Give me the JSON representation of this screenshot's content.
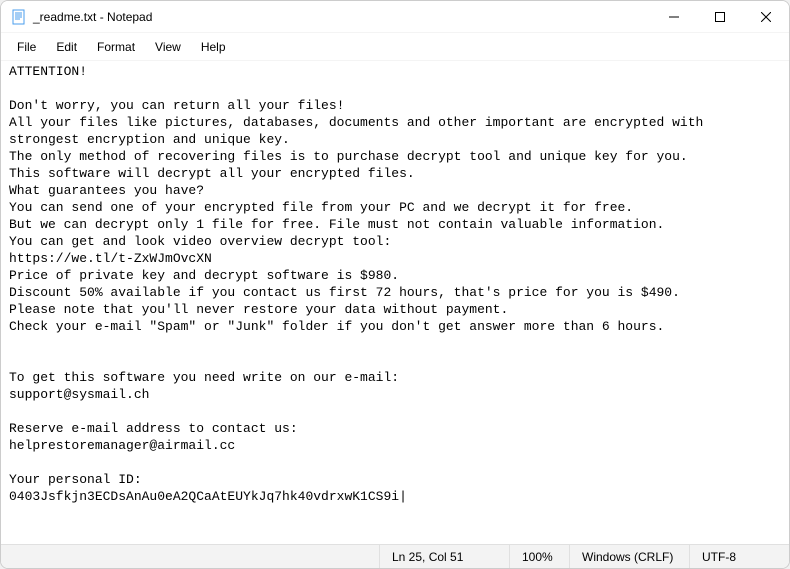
{
  "window": {
    "title": "_readme.txt - Notepad"
  },
  "menu": {
    "file": "File",
    "edit": "Edit",
    "format": "Format",
    "view": "View",
    "help": "Help"
  },
  "content": {
    "text": "ATTENTION!\n\nDon't worry, you can return all your files!\nAll your files like pictures, databases, documents and other important are encrypted with strongest encryption and unique key.\nThe only method of recovering files is to purchase decrypt tool and unique key for you.\nThis software will decrypt all your encrypted files.\nWhat guarantees you have?\nYou can send one of your encrypted file from your PC and we decrypt it for free.\nBut we can decrypt only 1 file for free. File must not contain valuable information.\nYou can get and look video overview decrypt tool:\nhttps://we.tl/t-ZxWJmOvcXN\nPrice of private key and decrypt software is $980.\nDiscount 50% available if you contact us first 72 hours, that's price for you is $490.\nPlease note that you'll never restore your data without payment.\nCheck your e-mail \"Spam\" or \"Junk\" folder if you don't get answer more than 6 hours.\n\n\nTo get this software you need write on our e-mail:\nsupport@sysmail.ch\n\nReserve e-mail address to contact us:\nhelprestoremanager@airmail.cc\n\nYour personal ID:\n0403Jsfkjn3ECDsAnAu0eA2QCaAtEUYkJq7hk40vdrxwK1CS9i"
  },
  "statusbar": {
    "position": "Ln 25, Col 51",
    "zoom": "100%",
    "line_ending": "Windows (CRLF)",
    "encoding": "UTF-8"
  }
}
